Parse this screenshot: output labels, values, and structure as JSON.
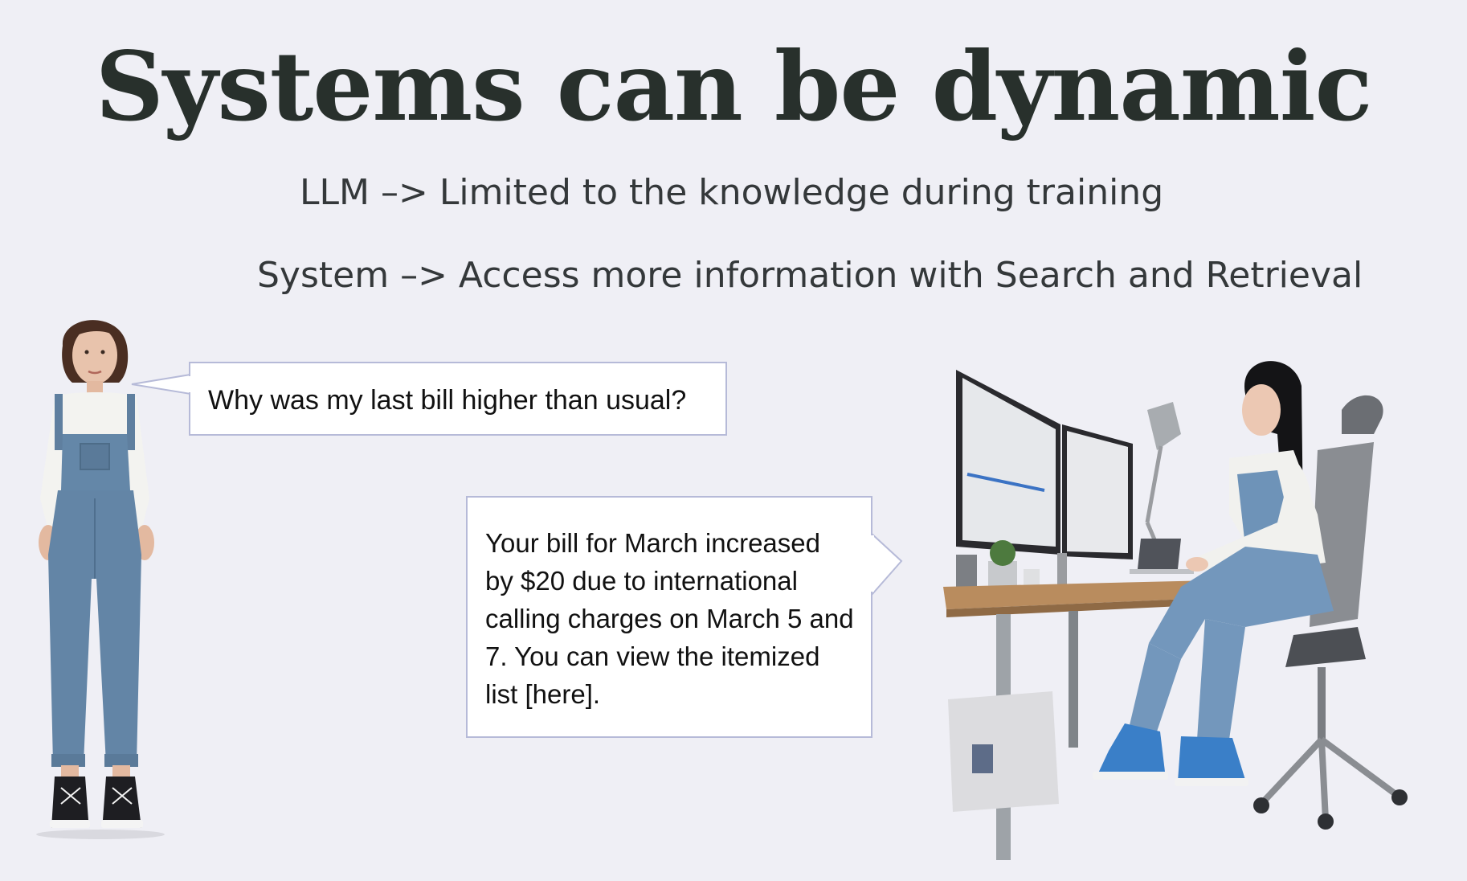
{
  "slide": {
    "title": "Systems can be dynamic",
    "line1": "LLM –> Limited to the knowledge during training",
    "line2": "System –> Access more information with Search and Retrieval"
  },
  "bubbles": {
    "question": "Why was my last bill higher than usual?",
    "answer": "Your bill for March increased by $20 due to international calling charges on March 5 and 7. You can view the itemized list [here]."
  },
  "colors": {
    "background": "#efeff5",
    "title": "#28302c",
    "bubble_border": "#b6bad8",
    "denim": "#5f7f9f",
    "desk_wood": "#b98c5e",
    "shoe_blue": "#3a7fc8"
  },
  "illustrations": {
    "left": "customer-woman-in-overalls",
    "right": "support-agent-at-desk"
  }
}
